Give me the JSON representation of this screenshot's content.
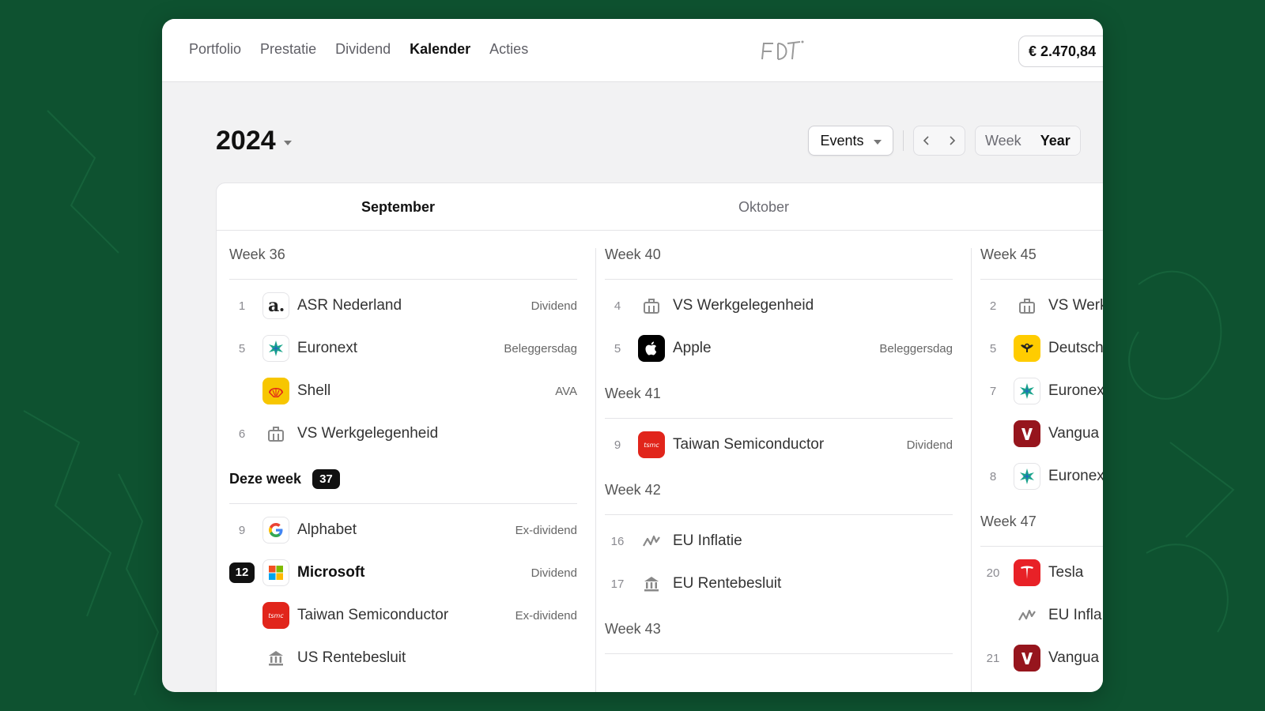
{
  "nav": {
    "items": [
      "Portfolio",
      "Prestatie",
      "Dividend",
      "Kalender",
      "Acties"
    ],
    "active_index": 3,
    "balance": "€ 2.470,84"
  },
  "calendar_view": {
    "year": "2024",
    "filter_label": "Events",
    "view_options": [
      "Week",
      "Year"
    ],
    "active_view": "Year",
    "months": [
      "September",
      "Oktober"
    ]
  },
  "columns": [
    {
      "weeks": [
        {
          "title": "Week 36",
          "events": [
            {
              "day": "1",
              "company": "ASR Nederland",
              "type": "Dividend",
              "icon": "asr-logo"
            },
            {
              "day": "5",
              "company": "Euronext",
              "type": "Beleggersdag",
              "icon": "euronext-logo"
            },
            {
              "day": "",
              "company": "Shell",
              "type": "AVA",
              "icon": "shell-logo"
            },
            {
              "day": "6",
              "company": "VS Werkgelegenheid",
              "type": "",
              "icon": "briefcase-icon"
            }
          ]
        },
        {
          "title": "Deze week",
          "badge": "37",
          "current": true,
          "events": [
            {
              "day": "9",
              "company": "Alphabet",
              "type": "Ex-dividend",
              "icon": "google-logo"
            },
            {
              "day": "12",
              "company": "Microsoft",
              "type": "Dividend",
              "icon": "microsoft-logo",
              "today": true
            },
            {
              "day": "",
              "company": "Taiwan Semiconductor",
              "type": "Ex-dividend",
              "icon": "tsmc-logo"
            },
            {
              "day": "",
              "company": "US Rentebesluit",
              "type": "",
              "icon": "bank-icon"
            }
          ]
        }
      ]
    },
    {
      "weeks": [
        {
          "title": "Week 40",
          "events": [
            {
              "day": "4",
              "company": "VS Werkgelegenheid",
              "type": "",
              "icon": "briefcase-icon"
            },
            {
              "day": "5",
              "company": "Apple",
              "type": "Beleggersdag",
              "icon": "apple-logo"
            }
          ]
        },
        {
          "title": "Week 41",
          "events": [
            {
              "day": "9",
              "company": "Taiwan Semiconductor",
              "type": "Dividend",
              "icon": "tsmc-logo"
            }
          ]
        },
        {
          "title": "Week 42",
          "events": [
            {
              "day": "16",
              "company": "EU Inflatie",
              "type": "",
              "icon": "inflation-icon"
            },
            {
              "day": "17",
              "company": "EU Rentebesluit",
              "type": "",
              "icon": "bank-icon"
            }
          ]
        },
        {
          "title": "Week 43",
          "events": []
        }
      ]
    },
    {
      "weeks": [
        {
          "title": "Week 45",
          "events": [
            {
              "day": "2",
              "company": "VS Werk",
              "type": "",
              "icon": "briefcase-icon"
            },
            {
              "day": "5",
              "company": "Deutsch",
              "type": "",
              "icon": "deutsche-post-logo"
            },
            {
              "day": "7",
              "company": "Euronex",
              "type": "",
              "icon": "euronext-logo"
            },
            {
              "day": "",
              "company": "Vangua",
              "type": "",
              "icon": "vanguard-logo"
            },
            {
              "day": "8",
              "company": "Euronex",
              "type": "",
              "icon": "euronext-logo"
            }
          ]
        },
        {
          "title": "Week 47",
          "events": [
            {
              "day": "20",
              "company": "Tesla",
              "type": "",
              "icon": "tesla-logo"
            },
            {
              "day": "",
              "company": "EU Infla",
              "type": "",
              "icon": "inflation-icon"
            },
            {
              "day": "21",
              "company": "Vangua",
              "type": "",
              "icon": "vanguard-logo"
            }
          ]
        }
      ]
    }
  ],
  "colors": {
    "background": "#0e5230",
    "shell": "#f7c600",
    "tsmc": "#e1251b",
    "vanguard": "#96151d",
    "tesla": "#e82127",
    "deutsche_post": "#ffcc00"
  }
}
